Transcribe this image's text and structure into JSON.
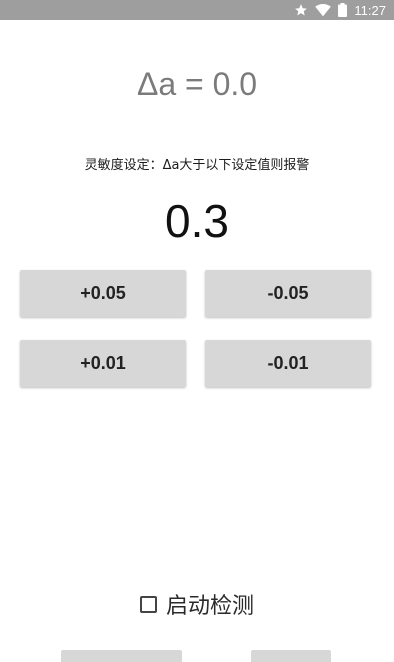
{
  "status_bar": {
    "time": "11:27",
    "icons": [
      "star-icon",
      "wifi-icon",
      "battery-icon"
    ]
  },
  "delta_display": "Δa = 0.0",
  "sensitivity_hint": "灵敏度设定：Δa大于以下设定值则报警",
  "threshold_value": "0.3",
  "buttons": {
    "plus_005": "+0.05",
    "minus_005": "-0.05",
    "plus_001": "+0.01",
    "minus_001": "-0.01"
  },
  "start_detection": {
    "label": "启动检测",
    "checked": false
  },
  "colors": {
    "status_bar": "#9e9e9e",
    "button": "#d7d7d7",
    "delta_text": "#7b7b7b"
  }
}
